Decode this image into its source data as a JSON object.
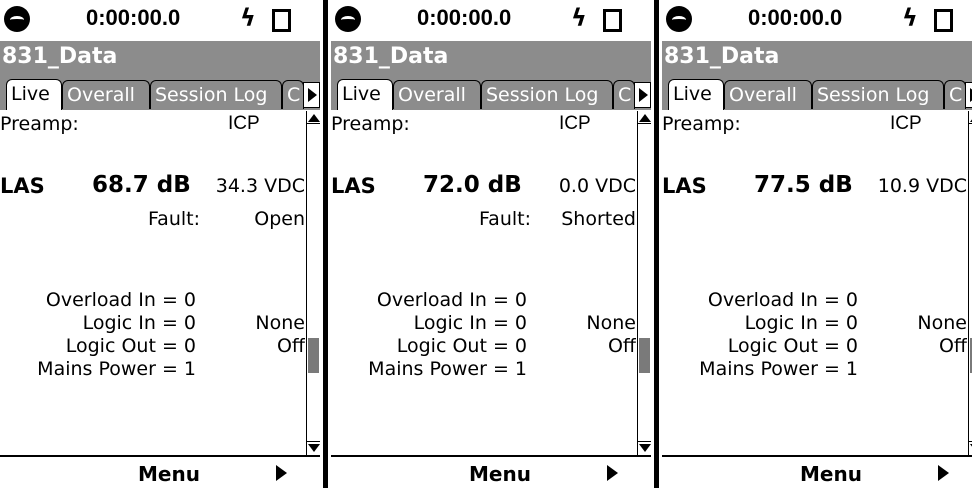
{
  "panels": [
    {
      "time": "0:00:00.0",
      "title": "831_Data",
      "tabs": [
        "Live",
        "Overall",
        "Session Log",
        "C"
      ],
      "preamp_label": "Preamp:",
      "preamp_value": "ICP",
      "metric_label": "LAS",
      "metric_value": "68.7 dB",
      "voltage": "34.3 VDC",
      "fault_label": "Fault:",
      "fault_value": "Open",
      "overload": "Overload In = 0",
      "logic_in": "Logic In = 0",
      "logic_in_value": "None",
      "logic_out": "Logic Out = 0",
      "logic_out_value": "Off",
      "mains": "Mains Power = 1",
      "menu": "Menu"
    },
    {
      "time": "0:00:00.0",
      "title": "831_Data",
      "tabs": [
        "Live",
        "Overall",
        "Session Log",
        "C"
      ],
      "preamp_label": "Preamp:",
      "preamp_value": "ICP",
      "metric_label": "LAS",
      "metric_value": "72.0 dB",
      "voltage": "0.0 VDC",
      "fault_label": "Fault:",
      "fault_value": "Shorted",
      "overload": "Overload In = 0",
      "logic_in": "Logic In = 0",
      "logic_in_value": "None",
      "logic_out": "Logic Out = 0",
      "logic_out_value": "Off",
      "mains": "Mains Power = 1",
      "menu": "Menu"
    },
    {
      "time": "0:00:00.0",
      "title": "831_Data",
      "tabs": [
        "Live",
        "Overall",
        "Session Log",
        "C"
      ],
      "preamp_label": "Preamp:",
      "preamp_value": "ICP",
      "metric_label": "LAS",
      "metric_value": "77.5 dB",
      "voltage": "10.9 VDC",
      "fault_label": "",
      "fault_value": "",
      "overload": "Overload In = 0",
      "logic_in": "Logic In = 0",
      "logic_in_value": "None",
      "logic_out": "Logic Out = 0",
      "logic_out_value": "Off",
      "mains": "Mains Power = 1",
      "menu": "Menu"
    }
  ],
  "icons": {
    "logo": "circle-logo-icon",
    "power": "lightning-bolt-icon",
    "battery": "battery-icon",
    "tab_scroll": "tab-scroll-right-icon",
    "menu_arrow": "right-triangle-icon"
  },
  "colors": {
    "title_bar": "#8c8c8c",
    "scroll_thumb": "#7a7a7a"
  }
}
